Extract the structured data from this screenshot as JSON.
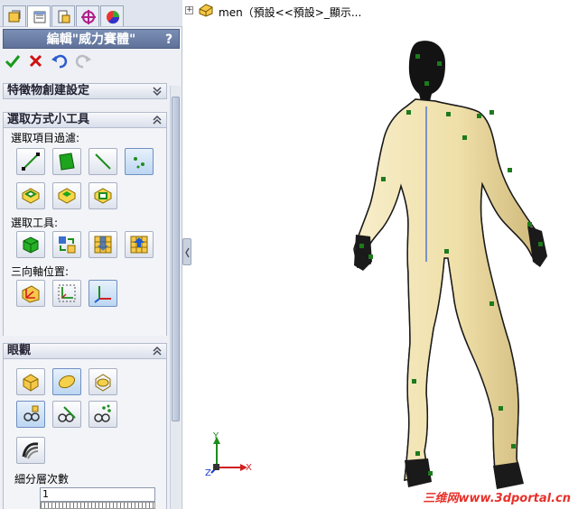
{
  "panel": {
    "title": "編輯\"威力賽體\"",
    "help": "?",
    "tabs": [
      "feature-manager",
      "property-manager",
      "configuration-manager",
      "dimxpert-manager",
      "display-manager"
    ],
    "actions": {
      "ok": "ok-check",
      "cancel": "cancel-x",
      "undo": "undo-arrow",
      "redo": "redo-arrow"
    }
  },
  "sections": {
    "feature_creation": {
      "title": "特徵物創建設定"
    },
    "selection_tools": {
      "title": "選取方式小工具",
      "filter_label": "選取項目過濾:",
      "tool_label": "選取工具:",
      "triad_label": "三向軸位置:"
    },
    "display": {
      "title": "眼觀",
      "subdiv_label": "細分層次數",
      "subdiv_value": "1"
    }
  },
  "viewport": {
    "tree_text": "men（預設<<預設>_顯示..."
  },
  "triad": {
    "x": "X",
    "y": "Y",
    "z": "Z"
  },
  "watermark": "三维网www.3dportal.cn",
  "colors": {
    "accent_title": "#5f7199",
    "model_fill": "#f2e6b8",
    "mesh": "#222222",
    "verts": "#1d7a1d",
    "watermark": "#e8312a"
  }
}
